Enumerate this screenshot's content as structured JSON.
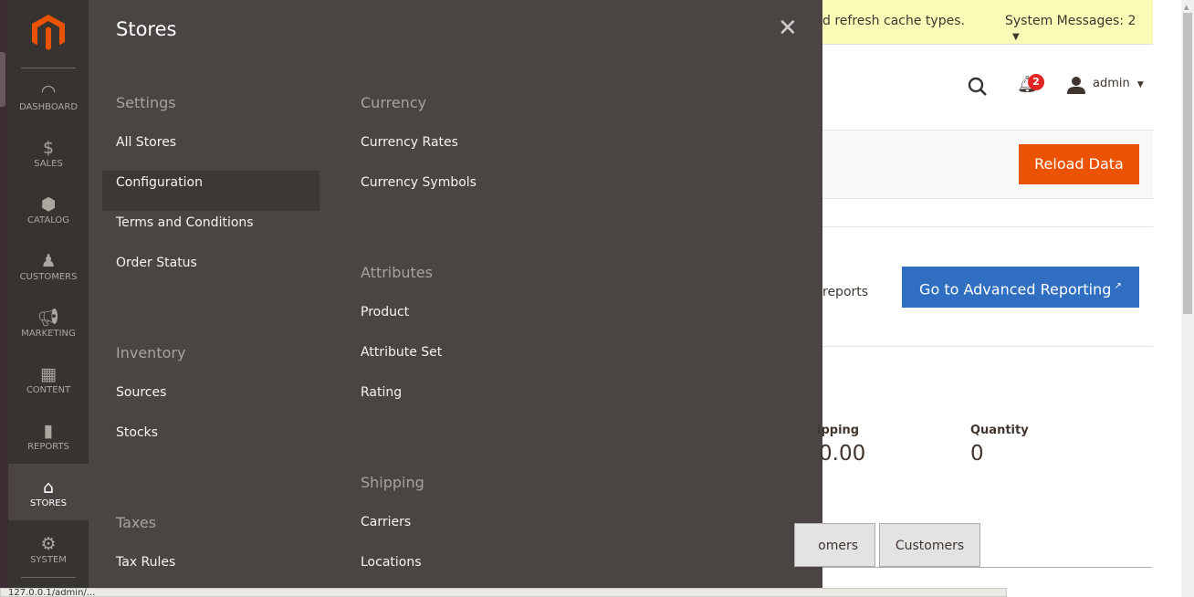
{
  "sidebar": {
    "items": [
      {
        "label": "DASHBOARD",
        "icon": "dashboard-icon"
      },
      {
        "label": "SALES",
        "icon": "dollar-icon"
      },
      {
        "label": "CATALOG",
        "icon": "box-icon"
      },
      {
        "label": "CUSTOMERS",
        "icon": "person-icon"
      },
      {
        "label": "MARKETING",
        "icon": "megaphone-icon"
      },
      {
        "label": "CONTENT",
        "icon": "layout-icon"
      },
      {
        "label": "REPORTS",
        "icon": "bar-chart-icon"
      },
      {
        "label": "STORES",
        "icon": "storefront-icon",
        "active": true
      },
      {
        "label": "SYSTEM",
        "icon": "gear-icon"
      }
    ]
  },
  "flyout": {
    "title": "Stores",
    "settings": {
      "title": "Settings",
      "items": [
        "All Stores",
        "Configuration",
        "Terms and Conditions",
        "Order Status"
      ]
    },
    "inventory": {
      "title": "Inventory",
      "items": [
        "Sources",
        "Stocks"
      ]
    },
    "taxes": {
      "title": "Taxes",
      "items": [
        "Tax Rules"
      ]
    },
    "currency": {
      "title": "Currency",
      "items": [
        "Currency Rates",
        "Currency Symbols"
      ]
    },
    "attributes": {
      "title": "Attributes",
      "items": [
        "Product",
        "Attribute Set",
        "Rating"
      ]
    },
    "shipping": {
      "title": "Shipping",
      "items": [
        "Carriers",
        "Locations"
      ]
    }
  },
  "message": {
    "text": "d refresh cache types.",
    "system": "System Messages: 2"
  },
  "header": {
    "notifications": "2",
    "user": "admin"
  },
  "page": {
    "reload": "Reload Data",
    "reports_text": "reports",
    "advanced": "Go to Advanced Reporting",
    "shipping_label": "ipping",
    "shipping_value": "0.00",
    "quantity_label": "Quantity",
    "quantity_value": "0",
    "tab1": "omers",
    "tab2": "Customers"
  },
  "status_url": "127.0.0.1/admin/..."
}
